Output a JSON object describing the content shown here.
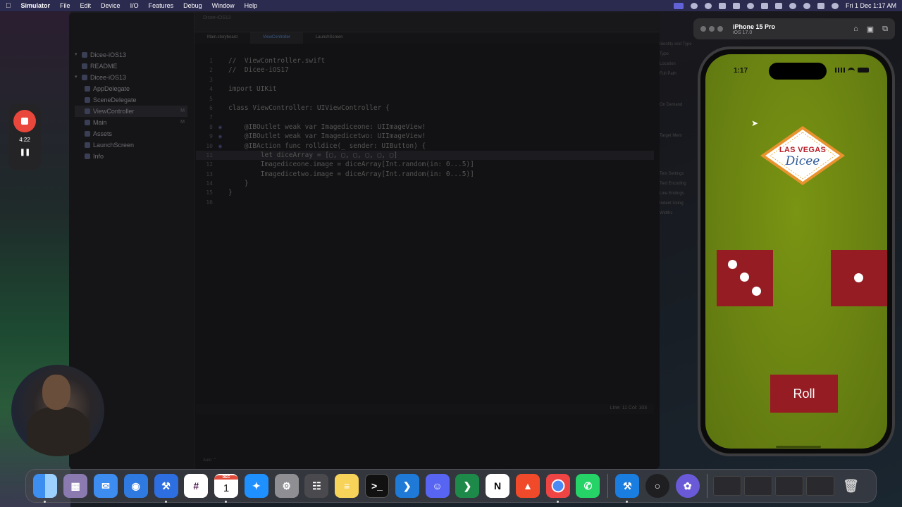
{
  "menubar": {
    "app": "Simulator",
    "items": [
      "File",
      "Edit",
      "Device",
      "I/O",
      "Features",
      "Debug",
      "Window",
      "Help"
    ],
    "datetime": "Fri 1 Dec  1:17 AM"
  },
  "recording": {
    "time": "4:22"
  },
  "xcode": {
    "project_title": "Dicee-iOS13",
    "tabs": [
      "Main.storyboard",
      "ViewController",
      "LaunchScreen"
    ],
    "navigator": [
      {
        "label": "Dicee-iOS13",
        "badge": ""
      },
      {
        "label": "README",
        "badge": ""
      },
      {
        "label": "Dicee-iOS13",
        "badge": ""
      },
      {
        "label": "AppDelegate",
        "badge": ""
      },
      {
        "label": "SceneDelegate",
        "badge": ""
      },
      {
        "label": "ViewController",
        "badge": "M"
      },
      {
        "label": "Main",
        "badge": "M"
      },
      {
        "label": "Assets",
        "badge": ""
      },
      {
        "label": "LaunchScreen",
        "badge": ""
      },
      {
        "label": "Info",
        "badge": ""
      }
    ],
    "code": [
      "//  ViewController.swift",
      "//  Dicee-iOS17",
      "",
      "import UIKit",
      "",
      "class ViewController: UIViewController {",
      "",
      "    @IBOutlet weak var Imagediceone: UIImageView!",
      "    @IBOutlet weak var Imagedicetwo: UIImageView!",
      "    @IBAction func rolldice(_ sender: UIButton) {",
      "        let diceArray = [▢, ▢, ▢, ▢, ▢, ▢]",
      "        Imagediceone.image = diceArray[Int.random(in: 0...5)]",
      "        Imagedicetwo.image = diceArray[Int.random(in: 0...5)]",
      "    }",
      "}",
      ""
    ],
    "line_numbers": [
      "1",
      "2",
      "3",
      "4",
      "5",
      "6",
      "7",
      "8",
      "9",
      "10",
      "11",
      "12",
      "13",
      "14",
      "15",
      "16"
    ],
    "status": "Line: 11  Col: 103",
    "bottom": "Auto ⌃"
  },
  "inspector": [
    "Identity and Type",
    "Type",
    "Location",
    "Full Path",
    "On Demand",
    "Target Mem",
    "Text Settings",
    "Text Encoding",
    "Line Endings",
    "Indent Using",
    "Widths"
  ],
  "simulator": {
    "device": "iPhone 15 Pro",
    "os": "iOS 17.0"
  },
  "app": {
    "time": "1:17",
    "logo_line1": "LAS VEGAS",
    "logo_line2": "Dicee",
    "dice": [
      3,
      1
    ],
    "roll_label": "Roll",
    "background": "#6f8a12",
    "dice_color": "#951c22"
  },
  "dock": {
    "calendar_month": "DEC",
    "calendar_day": "1"
  }
}
